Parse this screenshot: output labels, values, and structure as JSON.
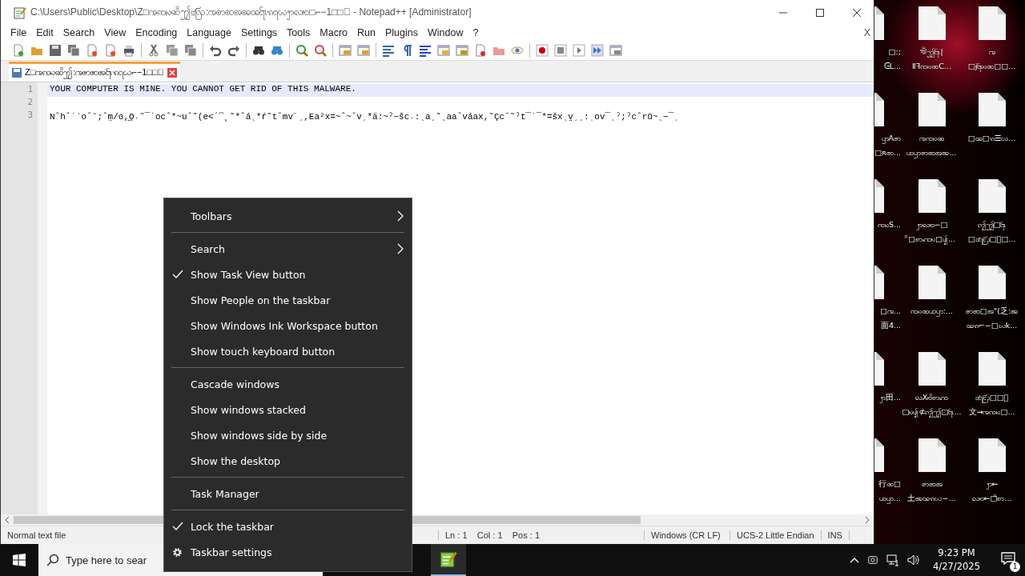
{
  "window": {
    "title": "C:\\Users\\Public\\Desktop\\Z□ꩠꩡꩢꩣꩰꩶ꩸ꩺ:ꩠꩦꩧꩨꩩꩪ꩷ꩫ꩹ꩬꩭꩮꩯ□⌐−1□□ꩻ - Notepad++ [Administrator]"
  },
  "menu": [
    "File",
    "Edit",
    "Search",
    "View",
    "Encoding",
    "Language",
    "Settings",
    "Tools",
    "Macro",
    "Run",
    "Plugins",
    "Window",
    "?"
  ],
  "menu_close": "X",
  "tabs": [
    {
      "label": "Z□ꩠꩡꩢꩣꩰꩶ:ꩠꩦꩧꩨ꩷ꩫ꩹ꩬ⌐−1□□ꩻ",
      "selected": true
    }
  ],
  "editor": {
    "lines": [
      {
        "number": "1",
        "text": "YOUR COMPUTER IS MINE. YOU CANNOT GET RID OF THIS MALWARE.",
        "current": true
      },
      {
        "number": "2",
        "current": false
      },
      {
        "number": "3",
        "text": "Nˆhˇ˙ˈoˆ˘;ˆm̤/ɞ,̱Ǫ˓˜¯˙ocˆ*~uˆ˜(e<ˊ⁀¸˜*ˆáˎ*ŕ˜tˆmv˝ˏ,Ea²x=~ˆ~ˇvˏ*ä:~ˀ−ŝc˒:ˎaˏ˜ˎaaˆváax,˜Çcˉ˜ˀt¯˙¯*=šxˎv̤ˏˏ:ˌov¯ˎˀ;ˀcˆrū~ˎ−¯ˌ",
        "current": false
      }
    ]
  },
  "status_bar": [
    "Normal text file",
    "Ln : 1    Col : 1    Pos : 1",
    "Windows (CR LF)",
    "UCS-2 Little Endian",
    "INS"
  ],
  "desktop_icons": [
    {
      "kind": "partial",
      "line1": "□:;",
      "line2": "ᕮL..."
    },
    {
      "kind": "full",
      "line1": "ঋঁꩶ꩷|",
      "line2": "ⅡꟻꩡꩢꩣC..."
    },
    {
      "kind": "full",
      "line1": "ꩠ",
      "line2": "□ɉ꩷ꩢꩣ□□..."
    },
    {
      "kind": "partial",
      "line1": "ꩥAꩦ",
      "line2": "□ʀꩧ..."
    },
    {
      "kind": "full",
      "line1": "ꩠꩡꩢꩣ",
      "line2": "ꩤꩥꩦꩧꩨꩩ..."
    },
    {
      "kind": "full",
      "line1": "□ꩪ□ꩫ☰ꩬ..."
    },
    {
      "kind": "partial",
      "line2": "ꩡꩢS..."
    },
    {
      "kind": "full",
      "line1": "ꩭꩮꩯ−□",
      "line2": "ꩰ□ꩱꩲꩳ□ꩴ..."
    },
    {
      "kind": "full",
      "line1": "ꩵꩶ□꩷",
      "line2": "□꩸꩹ꩺ□ꩻ□..."
    },
    {
      "kind": "partial",
      "line1": "□ꩠ...",
      "line2": "面4..."
    },
    {
      "kind": "full",
      "line1": "ꩡꩢꩣꩤꩥ:..."
    },
    {
      "kind": "full",
      "line1": "ꩦꩧ□ꩨ\"(乏:ꩩ",
      "line2": "ꩪꩫ⌐−□ꩬk..."
    },
    {
      "kind": "partial",
      "line2": "ꩭ田..."
    },
    {
      "kind": "full",
      "line1": "ꩮXꩯꩰꩱꩲ",
      "line2": "□ꩳꩴ⊄ꩵꩶ□꩷..."
    },
    {
      "kind": "full",
      "line1": "꩸꩹ꩺ□□ꩻ",
      "line2": "文→ꩠꩡꩢ□..."
    },
    {
      "kind": "partial",
      "line1": "行ꩣ□",
      "line2": "ꩤꩥ..."
    },
    {
      "kind": "full",
      "line1": "ꩦꩧꩨ",
      "line2": "土ꩩꩪꩫꩬ−..."
    },
    {
      "kind": "full",
      "line1": "ꩭ←",
      "line2": "ꩮꩯ←□ꩰꩱ..."
    }
  ],
  "context_menu": [
    {
      "kind": "submenu",
      "label": "Toolbars"
    },
    {
      "kind": "separator"
    },
    {
      "kind": "submenu",
      "label": "Search"
    },
    {
      "kind": "item",
      "label": "Show Task View button",
      "checked": true
    },
    {
      "kind": "item",
      "label": "Show People on the taskbar",
      "checked": false
    },
    {
      "kind": "item",
      "label": "Show Windows Ink Workspace button",
      "checked": false
    },
    {
      "kind": "item",
      "label": "Show touch keyboard button",
      "checked": false
    },
    {
      "kind": "separator"
    },
    {
      "kind": "item",
      "label": "Cascade windows",
      "checked": false
    },
    {
      "kind": "item",
      "label": "Show windows stacked",
      "checked": false
    },
    {
      "kind": "item",
      "label": "Show windows side by side",
      "checked": false
    },
    {
      "kind": "item",
      "label": "Show the desktop",
      "checked": false
    },
    {
      "kind": "separator"
    },
    {
      "kind": "item",
      "label": "Task Manager",
      "checked": false
    },
    {
      "kind": "separator"
    },
    {
      "kind": "item",
      "label": "Lock the taskbar",
      "checked": true
    },
    {
      "kind": "settings",
      "label": "Taskbar settings"
    }
  ],
  "taskbar": {
    "search": {
      "placeholder": "Type here to sear"
    },
    "time": "9:23 PM",
    "date": "4/27/2025",
    "notifications": "1"
  }
}
